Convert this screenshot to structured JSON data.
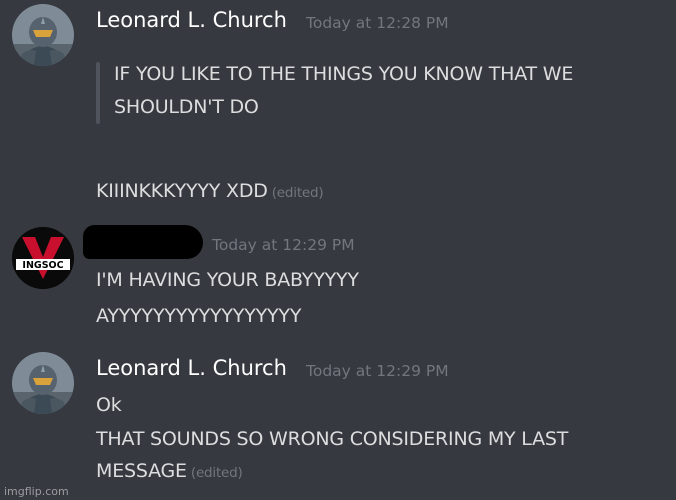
{
  "messages": [
    {
      "username": "Leonard L. Church",
      "timestamp": "Today at 12:28 PM",
      "quote_lines": [
        "IF YOU LIKE TO THE THINGS YOU KNOW THAT WE",
        "SHOULDN'T DO"
      ],
      "text": "KIIINKKKYYYY XDD",
      "edited": "(edited)",
      "avatar_icon": "armored-soldier-avatar-icon"
    },
    {
      "username": "",
      "timestamp": "Today at 12:29 PM",
      "lines": [
        "I'M HAVING YOUR BABYYYYY",
        "AYYYYYYYYYYYYYYYYY"
      ],
      "avatar_text": "INGSOC",
      "avatar_icon": "ingsoc-logo-avatar-icon"
    },
    {
      "username": "Leonard L. Church",
      "timestamp": "Today at 12:29 PM",
      "lines": [
        "Ok",
        "THAT SOUNDS SO WRONG CONSIDERING MY LAST",
        "MESSAGE"
      ],
      "edited": "(edited)",
      "avatar_icon": "armored-soldier-avatar-icon"
    }
  ],
  "watermark": "imgflip.com",
  "colors": {
    "background": "#36393f",
    "username": "#ffffff",
    "text": "#dcddde",
    "muted": "#72767d",
    "quote_bar": "#4f545c",
    "ingsoc_red": "#c8102e"
  }
}
